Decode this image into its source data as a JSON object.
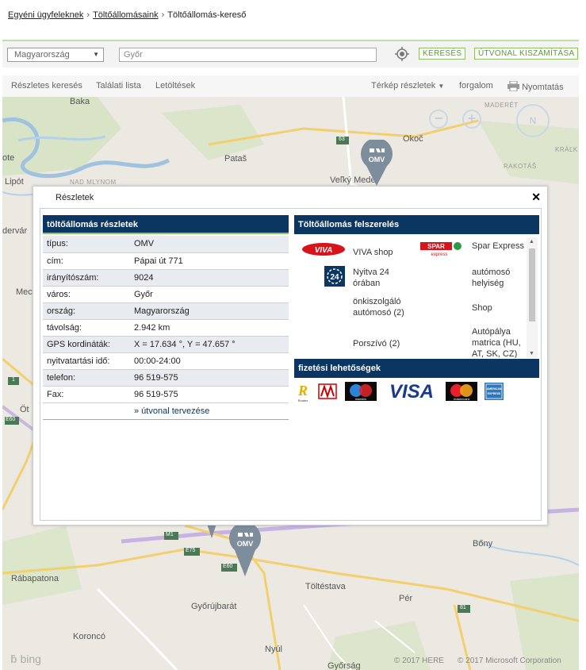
{
  "breadcrumb": {
    "item1": "Egyéni ügyfeleknek",
    "item2": "Töltőállomásaink",
    "item3": "Töltőállomás-kereső",
    "sep": "›"
  },
  "search": {
    "country": "Magyarország",
    "city_value": "Győr",
    "search_button": "KERESÉS",
    "route_button": "ÚTVONAL KISZÁMÍTÁSA"
  },
  "toolbar": {
    "detailed_search": "Részletes keresés",
    "result_list": "Találati lista",
    "downloads": "Letöltések",
    "map_details": "Térkép részletek",
    "traffic": "forgalom",
    "print": "Nyomtatás"
  },
  "map": {
    "places": {
      "baka": "Baka",
      "patas": "Pataš",
      "velky_meder": "Veľký Meder",
      "okoc": "Okoč",
      "lipot": "Lipót",
      "dervar": "dervár",
      "mec": "Mec",
      "ote": "ote",
      "ot": "Öt",
      "bony": "Bőny",
      "rabapatona": "Rábapatona",
      "toltestava": "Töltéstava",
      "gyorujbarat": "Győrújbarát",
      "per": "Pér",
      "koroncó": "Koroncó",
      "nyul": "Nyúl",
      "gyorsag": "Győrság",
      "maderet": "MADERÉT",
      "rakotas": "RAKOTÁŠ",
      "krall": "KRÁĽK",
      "nad_mlynom": "NAD MLYNOM"
    },
    "road_labels": {
      "r63": "63",
      "r1": "1",
      "e60a": "E60",
      "m1": "M1",
      "e75": "E75",
      "e60b": "E60",
      "r81": "81"
    },
    "pin_brand": "OMV",
    "compass": "N",
    "bing": "bing",
    "copyright_here": "© 2017 HERE",
    "copyright_ms": "© 2017 Microsoft Corporation"
  },
  "dialog": {
    "title": "Részletek",
    "close": "✕",
    "details_header": "töltőállomás részletek",
    "equipment_header": "Töltőállomás felszerelés",
    "payment_header": "fizetési lehetőségek",
    "rows": [
      {
        "label": "típus:",
        "value": "OMV"
      },
      {
        "label": "cím:",
        "value": "Pápai út 771"
      },
      {
        "label": "irányítószám:",
        "value": "9024"
      },
      {
        "label": "város:",
        "value": "Győr"
      },
      {
        "label": "ország:",
        "value": "Magyarország"
      },
      {
        "label": "távolság:",
        "value": "2.942 km"
      },
      {
        "label": "GPS kordináták:",
        "value": "X = 17.634 °, Y = 47.657 °"
      },
      {
        "label": "nyitvatartási idő:",
        "value": "00:00-24:00"
      },
      {
        "label": "telefon:",
        "value": "96 519-575"
      },
      {
        "label": "Fax:",
        "value": "96 519-575"
      }
    ],
    "route_link": "» útvonal tervezése",
    "equipment": {
      "viva_shop": "VIVA shop",
      "spar_express": "Spar Express",
      "open_24": "Nyitva 24 órában",
      "car_wash": "autómosó helyiség",
      "self_wash": "önkiszolgáló autómosó (2)",
      "shop": "Shop",
      "vacuum": "Porszívó (2)",
      "vignette": "Autópálya matrica (HU, AT, SK, CZ)",
      "viva_logo": "VIVA",
      "spar_logo": "SPAR",
      "spar_sub": "express",
      "h24_logo": "24"
    },
    "payment_logos": {
      "visa": "VISA",
      "maestro": "maestro",
      "mastercard": "mastercard",
      "amex": "AMERICAN EXPRESS"
    }
  }
}
